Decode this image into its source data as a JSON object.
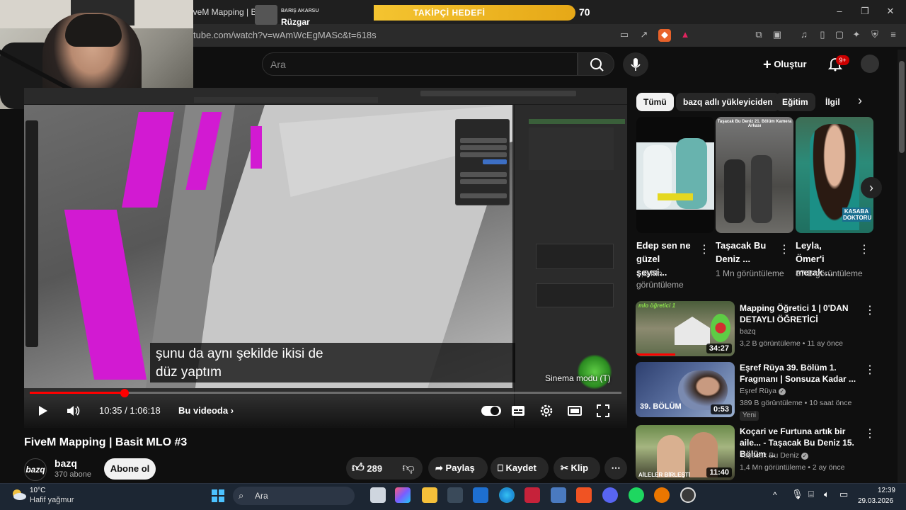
{
  "browser": {
    "tab_title": "FiveM Mapping | Basit MLO #3",
    "tab_title_visible": "iveM Mapping | Basi",
    "url": "tube.com/watch?v=wAmWcEgMASc&t=618s",
    "window_controls": [
      "–",
      "❐",
      "✕"
    ]
  },
  "stream_overlay": {
    "music_artist": "BARIŞ AKARSU",
    "music_title": "Rüzgar",
    "follow_goal_label": "TAKİPÇİ HEDEFİ",
    "follow_goal_count": "70",
    "follow_goal_progress": 0.62
  },
  "header": {
    "search_placeholder": "Ara",
    "create_label": "Oluştur",
    "notification_count": "9+"
  },
  "player": {
    "subtitle_line1": "şunu da aynı şekilde ikisi de",
    "subtitle_line2": "düz yaptım",
    "time_current": "10:35",
    "time_total": "1:06:18",
    "time_display": "10:35 / 1:06:18",
    "chapter_label": "Bu videoda",
    "cinema_mode_label": "Sinema modu",
    "cinema_mode_key": "T",
    "progress": 0.16
  },
  "video": {
    "title": "FiveM Mapping | Basit MLO #3",
    "channel_name": "bazq",
    "channel_logo_text": "bazq",
    "subscribers": "370 abone",
    "subscribe_label": "Abone ol",
    "like_count": "289",
    "share_label": "Paylaş",
    "save_label": "Kaydet",
    "clip_label": "Klip"
  },
  "chips": [
    "Tümü",
    "bazq adlı yükleyiciden",
    "Eğitim",
    "İlgil"
  ],
  "shorts": [
    {
      "title": "Edep sen ne güzel şeysi...",
      "views": "1,8 Mn görüntüleme",
      "thumb_text": ""
    },
    {
      "title": "Taşacak Bu Deniz ...",
      "views": "1 Mn görüntüleme",
      "thumb_text": "Taşacak Bu Deniz 21. Bölüm Kamera Arkası"
    },
    {
      "title": "Leyla, Ömer'i merak ...",
      "views": "87 B görüntüleme",
      "thumb_text": "KASABA DOKTORU"
    }
  ],
  "recommendations": [
    {
      "title": "Mapping Öğretici 1 | 0'DAN DETAYLI ÖĞRETİCİ",
      "channel": "bazq",
      "meta": "3,2 B görüntüleme • 11 ay önce",
      "duration": "34:27",
      "badge": "",
      "thumb_text": "mlo öğretici 1"
    },
    {
      "title": "Eşref Rüya 39. Bölüm 1. Fragmanı | Sonsuza Kadar ...",
      "channel": "Eşref Rüya",
      "meta": "389 B görüntüleme • 10 saat önce",
      "duration": "0:53",
      "badge": "Yeni",
      "thumb_text": "39. BÖLÜM"
    },
    {
      "title": "Koçari ve Furtuna artık bir aile... - Taşacak Bu Deniz 15. Bölüm ...",
      "channel": "Taşacak Bu Deniz",
      "meta": "1,4 Mn görüntüleme • 2 ay önce",
      "duration": "11:40",
      "badge": "",
      "thumb_text": "AİLELER BİRLEŞTİ"
    }
  ],
  "taskbar": {
    "weather_temp": "10°C",
    "weather_desc": "Hafif yağmur",
    "search_label": "Ara",
    "time": "12:39",
    "date": "29.03.2026"
  },
  "colors": {
    "accent_red": "#ff0000",
    "goal_yellow": "#f4c430",
    "blender_pink": "#d21ad2"
  }
}
